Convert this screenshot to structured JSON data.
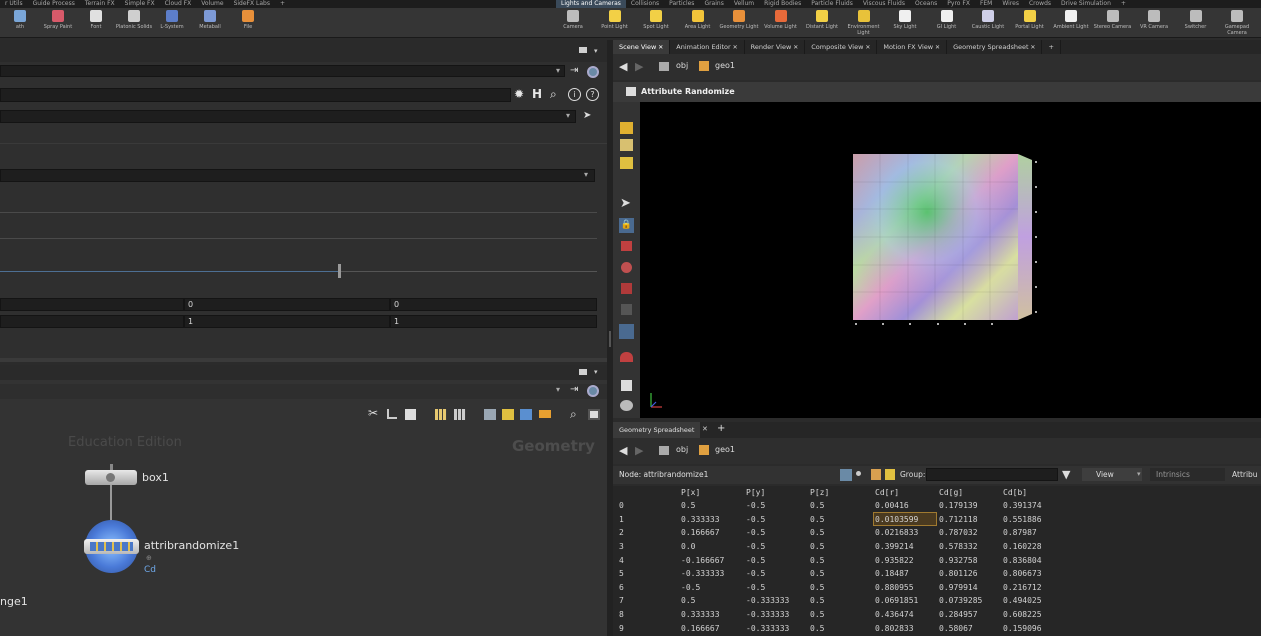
{
  "shelf_tabs_left": [
    "r Utils",
    "Guide Process",
    "Terrain FX",
    "Simple FX",
    "Cloud FX",
    "Volume",
    "SideFX Labs",
    "+"
  ],
  "shelf_tabs_right": [
    "Lights and Cameras",
    "Collisions",
    "Particles",
    "Grains",
    "Vellum",
    "Rigid Bodies",
    "Particle Fluids",
    "Viscous Fluids",
    "Oceans",
    "Pyro FX",
    "FEM",
    "Wires",
    "Crowds",
    "Drive Simulation",
    "+"
  ],
  "tools_left": [
    {
      "label": "ath",
      "color": "#7aa6d8"
    },
    {
      "label": "Spray Paint",
      "color": "#d85a6a"
    },
    {
      "label": "Font",
      "color": "#e0e0e0"
    },
    {
      "label": "Platonic Solids",
      "color": "#cfcfcf"
    },
    {
      "label": "L-System",
      "color": "#5d7ec9"
    },
    {
      "label": "Metaball",
      "color": "#7d9ad6"
    },
    {
      "label": "File",
      "color": "#e8903a"
    }
  ],
  "tools_right": [
    {
      "label": "Camera",
      "color": "#bcbcbc"
    },
    {
      "label": "Point Light",
      "color": "#f2d046"
    },
    {
      "label": "Spot Light",
      "color": "#f2d046"
    },
    {
      "label": "Area Light",
      "color": "#f2c43a"
    },
    {
      "label": "Geometry Light",
      "color": "#e8903a"
    },
    {
      "label": "Volume Light",
      "color": "#e86a3a"
    },
    {
      "label": "Distant Light",
      "color": "#f2d046"
    },
    {
      "label": "Environment Light",
      "color": "#e8c23a"
    },
    {
      "label": "Sky Light",
      "color": "#f0f0f0"
    },
    {
      "label": "GI Light",
      "color": "#f0f0f0"
    },
    {
      "label": "Caustic Light",
      "color": "#cfcfe8"
    },
    {
      "label": "Portal Light",
      "color": "#f2d046"
    },
    {
      "label": "Ambient Light",
      "color": "#f0f0f0"
    },
    {
      "label": "Stereo Camera",
      "color": "#bcbcbc"
    },
    {
      "label": "VR Camera",
      "color": "#bcbcbc"
    },
    {
      "label": "Switcher",
      "color": "#bcbcbc"
    },
    {
      "label": "Gamepad Camera",
      "color": "#bcbcbc"
    }
  ],
  "params": {
    "r1c1": "0",
    "r1c2": "0",
    "r2c1": "1",
    "r2c2": "1"
  },
  "network": {
    "watermark": "Education Edition",
    "context": "Geometry",
    "node1": "box1",
    "node2": "attribrandomize1",
    "node2_sub": "Cd",
    "partial_node": "nge1"
  },
  "pane_tabs": [
    {
      "label": "Scene View",
      "active": true
    },
    {
      "label": "Animation Editor",
      "active": false
    },
    {
      "label": "Render View",
      "active": false
    },
    {
      "label": "Composite View",
      "active": false
    },
    {
      "label": "Motion FX View",
      "active": false
    },
    {
      "label": "Geometry Spreadsheet",
      "active": false
    }
  ],
  "path": {
    "obj": "obj",
    "geo": "geo1"
  },
  "viewer_title": "Attribute Randomize",
  "spreadsheet": {
    "tab": "Geometry Spreadsheet",
    "node_label": "Node: attribrandomize1",
    "group_label": "Group:",
    "view_label": "View",
    "intrinsics_label": "Intrinsics",
    "attrib_label": "Attribu",
    "columns": [
      "",
      "P[x]",
      "P[y]",
      "P[z]",
      "Cd[r]",
      "Cd[g]",
      "Cd[b]"
    ],
    "rows": [
      [
        "0",
        "0.5",
        "-0.5",
        "0.5",
        "0.00416",
        "0.179139",
        "0.391374"
      ],
      [
        "1",
        "0.333333",
        "-0.5",
        "0.5",
        "0.0103599",
        "0.712118",
        "0.551886"
      ],
      [
        "2",
        "0.166667",
        "-0.5",
        "0.5",
        "0.0216833",
        "0.787032",
        "0.87987"
      ],
      [
        "3",
        "0.0",
        "-0.5",
        "0.5",
        "0.399214",
        "0.578332",
        "0.160228"
      ],
      [
        "4",
        "-0.166667",
        "-0.5",
        "0.5",
        "0.935822",
        "0.932758",
        "0.836804"
      ],
      [
        "5",
        "-0.333333",
        "-0.5",
        "0.5",
        "0.18487",
        "0.801126",
        "0.806673"
      ],
      [
        "6",
        "-0.5",
        "-0.5",
        "0.5",
        "0.880955",
        "0.979914",
        "0.216712"
      ],
      [
        "7",
        "0.5",
        "-0.333333",
        "0.5",
        "0.0691851",
        "0.0739285",
        "0.494025"
      ],
      [
        "8",
        "0.333333",
        "-0.333333",
        "0.5",
        "0.436474",
        "0.284957",
        "0.608225"
      ],
      [
        "9",
        "0.166667",
        "-0.333333",
        "0.5",
        "0.802833",
        "0.58067",
        "0.159096"
      ]
    ]
  }
}
